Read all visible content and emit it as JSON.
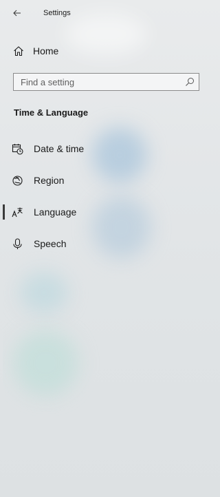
{
  "window": {
    "title": "Settings"
  },
  "nav": {
    "home_label": "Home"
  },
  "search": {
    "placeholder": "Find a setting",
    "value": ""
  },
  "section": {
    "title": "Time & Language"
  },
  "items": [
    {
      "label": "Date & time",
      "icon": "calendar-clock-icon",
      "selected": false
    },
    {
      "label": "Region",
      "icon": "globe-icon",
      "selected": false
    },
    {
      "label": "Language",
      "icon": "language-icon",
      "selected": true
    },
    {
      "label": "Speech",
      "icon": "microphone-icon",
      "selected": false
    }
  ],
  "colors": {
    "background": "#e3e6e8",
    "text": "#1a1a1a",
    "selection_indicator": "#3a3a3a",
    "search_border": "#8a8a8a"
  }
}
